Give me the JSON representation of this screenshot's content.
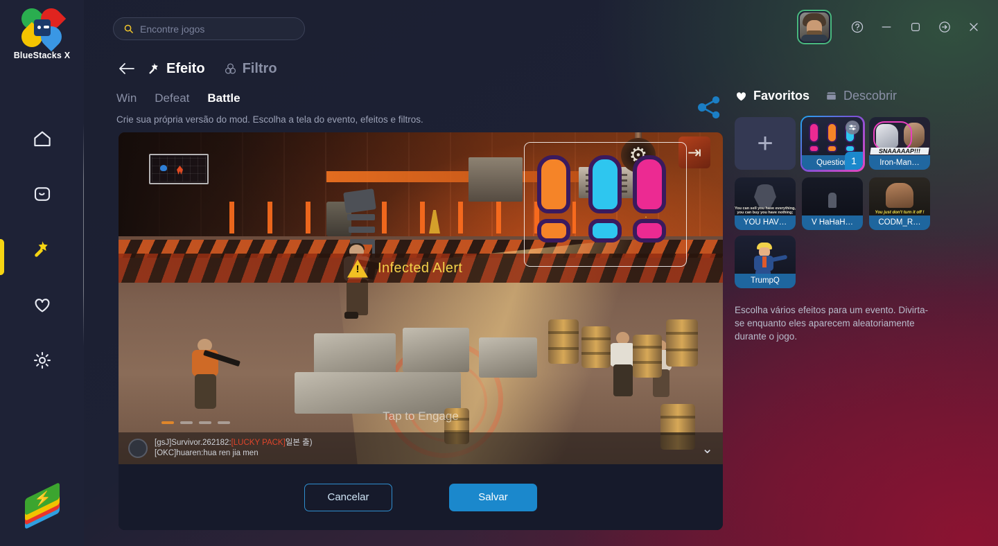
{
  "app": {
    "brand_name": "BlueStacks X",
    "logo_icon": "bluestacks-petals-logo"
  },
  "search": {
    "placeholder": "Encontre jogos",
    "value": "",
    "icon": "search-icon"
  },
  "window_controls": {
    "avatar_icon": "user-avatar",
    "help_icon": "help-circle-icon",
    "minimize_icon": "minimize-icon",
    "maximize_icon": "maximize-icon",
    "logout_icon": "logout-arrow-icon",
    "close_icon": "close-icon"
  },
  "sidebar": {
    "items": [
      {
        "name": "home",
        "icon": "home-icon",
        "active": false
      },
      {
        "name": "my-games",
        "icon": "game-box-icon",
        "active": false
      },
      {
        "name": "effects",
        "icon": "magic-wand-icon",
        "active": true
      },
      {
        "name": "favorites",
        "icon": "heart-icon",
        "active": false
      },
      {
        "name": "settings",
        "icon": "gear-icon",
        "active": false
      }
    ],
    "app_icon": "bluestacks-stack-icon"
  },
  "content_header": {
    "back_icon": "back-arrow-icon",
    "modes": [
      {
        "label": "Efeito",
        "icon": "magic-wand-icon",
        "active": true
      },
      {
        "label": "Filtro",
        "icon": "filter-circles-icon",
        "active": false
      }
    ]
  },
  "tabs": [
    {
      "label": "Win",
      "active": false
    },
    {
      "label": "Defeat",
      "active": false
    },
    {
      "label": "Battle",
      "active": true
    }
  ],
  "subtitle": "Crie sua própria versão do mod. Escolha a tela do evento, efeitos e filtros.",
  "share": {
    "icon": "share-icon",
    "color": "#1b7ec4"
  },
  "preview": {
    "alert_text": "Infected Alert",
    "warning_icon": "warning-triangle-icon",
    "tap_text": "Tap to Engage",
    "gear_icon": "gear-wheel-icon",
    "exit_icon": "exit-door-icon",
    "chevron_icon": "chevron-down-icon",
    "chat": {
      "line1_prefix": "[gsJ]Survivor.262182:",
      "line1_highlight": "[LUCKY PACK]",
      "line1_suffix": "일본 출)",
      "line2": "[OKC]huaren:hua ren jia men"
    },
    "pagination": {
      "count": 4,
      "active_index": 0
    }
  },
  "actions": {
    "cancel_label": "Cancelar",
    "save_label": "Salvar",
    "save_color": "#1b88cc"
  },
  "right_panel": {
    "tabs": [
      {
        "label": "Favoritos",
        "icon": "heart-filled-icon",
        "active": true
      },
      {
        "label": "Descobrir",
        "icon": "store-icon",
        "active": false
      }
    ],
    "add_tile": {
      "icon": "plus-icon",
      "label": ""
    },
    "effects": [
      {
        "label": "Question",
        "art": "exclamation-marks",
        "selected": true,
        "count_badge": "1",
        "settings_icon": "sliders-icon"
      },
      {
        "label": "Iron-Man…",
        "art": "ironman-snap",
        "caption_art": "SNAAAAAP!!!",
        "selected": false
      },
      {
        "label": "YOU HAV…",
        "art": "batman-quote",
        "caption_art": "You can sell you have everything, you can buy you have nothing;",
        "selected": false
      },
      {
        "label": "V HaHaH…",
        "art": "v-figure",
        "selected": false
      },
      {
        "label": "CODM_R…",
        "art": "codm-celebration",
        "caption_art": "You just don't turn it off !",
        "selected": false
      },
      {
        "label": "TrumpQ",
        "art": "trump-dance",
        "selected": false
      }
    ],
    "help_text": "Escolha vários efeitos para um evento. Divirta-se enquanto eles aparecem aleatoriamente durante o jogo."
  },
  "theme": {
    "accent_blue": "#1b88cc",
    "accent_yellow": "#f6d513",
    "panel_bg": "#1e2236",
    "selected_gradient": "#1fa7f0 → #7a53d8 → #e747c0"
  }
}
